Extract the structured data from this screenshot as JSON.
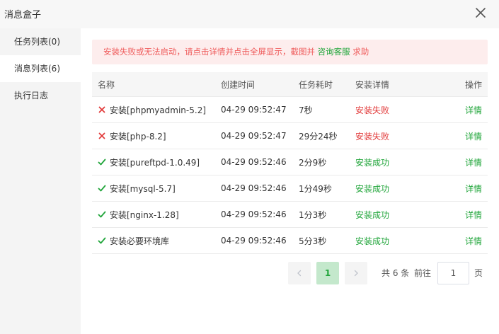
{
  "window": {
    "title": "消息盒子",
    "close_icon": "close-icon"
  },
  "sidebar": {
    "items": [
      {
        "label": "任务列表(0)",
        "active": false
      },
      {
        "label": "消息列表(6)",
        "active": true
      },
      {
        "label": "执行日志",
        "active": false
      }
    ]
  },
  "alert": {
    "text_before": "安装失败或无法启动，请点击详情并点击全屏显示，截图并 ",
    "link": "咨询客服",
    "text_after": " 求助",
    "color": "#ef5c5c",
    "background": "#fdeded"
  },
  "table": {
    "headers": {
      "name": "名称",
      "time": "创建时间",
      "duration": "任务耗时",
      "status": "安装详情",
      "op": "操作"
    },
    "rows": [
      {
        "icon": "cross-icon",
        "name": "安装[phpmyadmin-5.2]",
        "time": "04-29 09:52:47",
        "duration": "7秒",
        "status": "安装失败",
        "result": "fail",
        "op": "详情"
      },
      {
        "icon": "cross-icon",
        "name": "安装[php-8.2]",
        "time": "04-29 09:52:47",
        "duration": "29分24秒",
        "status": "安装失败",
        "result": "fail",
        "op": "详情"
      },
      {
        "icon": "check-icon",
        "name": "安装[pureftpd-1.0.49]",
        "time": "04-29 09:52:46",
        "duration": "2分9秒",
        "status": "安装成功",
        "result": "ok",
        "op": "详情"
      },
      {
        "icon": "check-icon",
        "name": "安装[mysql-5.7]",
        "time": "04-29 09:52:46",
        "duration": "1分49秒",
        "status": "安装成功",
        "result": "ok",
        "op": "详情"
      },
      {
        "icon": "check-icon",
        "name": "安装[nginx-1.28]",
        "time": "04-29 09:52:46",
        "duration": "1分3秒",
        "status": "安装成功",
        "result": "ok",
        "op": "详情"
      },
      {
        "icon": "check-icon",
        "name": "安装必要环境库",
        "time": "04-29 09:52:46",
        "duration": "5分3秒",
        "status": "安装成功",
        "result": "ok",
        "op": "详情"
      }
    ]
  },
  "pagination": {
    "current_page": "1",
    "total": "共 6 条",
    "goto_label": "前往",
    "goto_value": "1",
    "page_unit": "页"
  },
  "colors": {
    "accent": "#20a53a",
    "fail": "#e23c3c"
  }
}
